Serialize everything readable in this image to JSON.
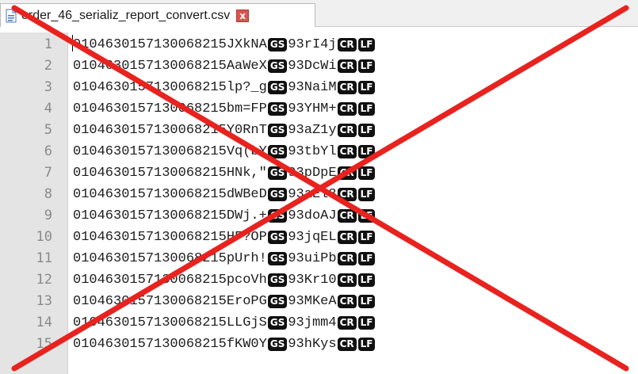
{
  "tab": {
    "title": "order_46_serializ_report_convert.csv",
    "close_label": "x",
    "file_icon": "csv-file-icon"
  },
  "control_chars": {
    "gs": "GS",
    "cr": "CR",
    "lf": "LF"
  },
  "lines": [
    {
      "num": "1",
      "before": "010463015713006821​5JXkNA",
      "after": "93rI4j"
    },
    {
      "num": "2",
      "before": "0104630157130068215AaWeX",
      "after": "93DcWi"
    },
    {
      "num": "3",
      "before": "0104630157130068215lp?_g",
      "after": "93NaiM"
    },
    {
      "num": "4",
      "before": "0104630157130068215bm=FP",
      "after": "93YHM+"
    },
    {
      "num": "5",
      "before": "0104630157130068215Y0RnT",
      "after": "93aZ1y"
    },
    {
      "num": "6",
      "before": "0104630157130068215Vq(bY",
      "after": "93tbYl"
    },
    {
      "num": "7",
      "before": "0104630157130068215HNk,\"",
      "after": "93pDpE"
    },
    {
      "num": "8",
      "before": "0104630157130068215dWBeD",
      "after": "93aEl8"
    },
    {
      "num": "9",
      "before": "0104630157130068215DWj.+",
      "after": "93doAJ"
    },
    {
      "num": "10",
      "before": "0104630157130068215HF?OP",
      "after": "93jqEL"
    },
    {
      "num": "11",
      "before": "0104630157130068215pUrh!",
      "after": "93uiPb"
    },
    {
      "num": "12",
      "before": "0104630157130068215pcoVh",
      "after": "93Kr10"
    },
    {
      "num": "13",
      "before": "0104630157130068215EroPG",
      "after": "93MKeA"
    },
    {
      "num": "14",
      "before": "0104630157130068215LLGjS",
      "after": "93jmm4"
    },
    {
      "num": "15",
      "before": "0104630157130068215fKW0Y",
      "after": "93hKys"
    }
  ],
  "overlay": {
    "type": "red-x-cross",
    "color": "#e8231f"
  }
}
